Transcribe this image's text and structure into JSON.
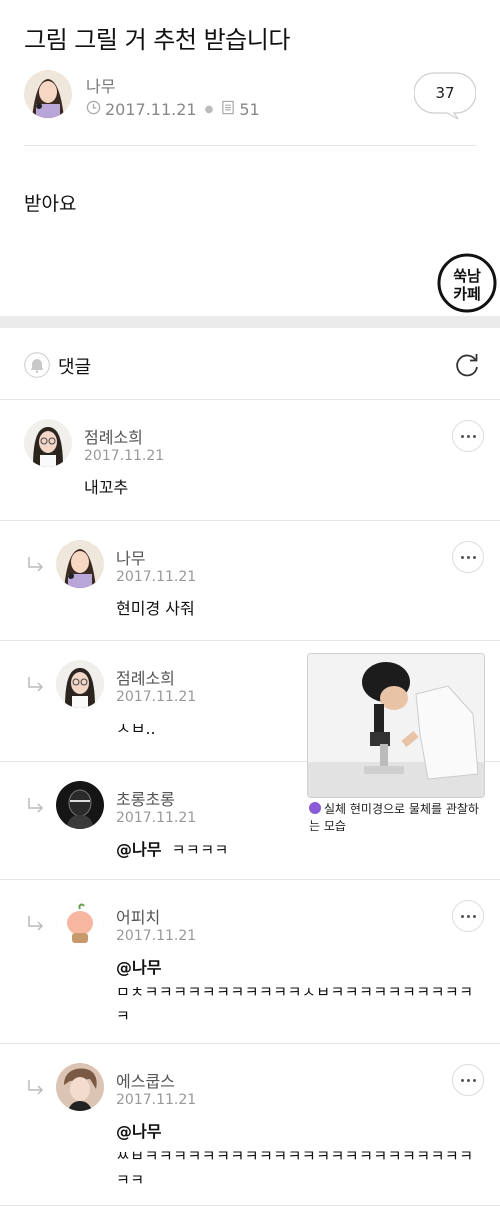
{
  "post": {
    "title": "그림 그릴 거 추천 받습니다",
    "author": "나무",
    "date": "2017.11.21",
    "views": "51",
    "comment_count": "37",
    "body": "받아요",
    "badge_line1": "쑥남",
    "badge_line2": "카페"
  },
  "comments_section": {
    "label": "댓글",
    "icons": [
      "bell-icon",
      "refresh-icon"
    ]
  },
  "comments": [
    {
      "author": "점례소희",
      "date": "2017.11.21",
      "text": "내꼬추",
      "reply": false
    },
    {
      "author": "나무",
      "date": "2017.11.21",
      "text": "현미경 사줘",
      "reply": true
    },
    {
      "author": "점례소희",
      "date": "2017.11.21",
      "text": "ㅅㅂ..",
      "reply": true
    },
    {
      "author": "초롱초롱",
      "date": "2017.11.21",
      "mention": "@나무",
      "text": "ㅋㅋㅋㅋ",
      "reply": true
    },
    {
      "author": "어피치",
      "date": "2017.11.21",
      "mention": "@나무",
      "text": "ㅁㅊㅋㅋㅋㅋㅋㅋㅋㅋㅋㅋㅋㅅㅂㅋㅋㅋㅋㅋㅋㅋㅋㅋㅋㅋ",
      "reply": true
    },
    {
      "author": "에스쿱스",
      "date": "2017.11.21",
      "mention": "@나무",
      "text": "ㅆㅂㅋㅋㅋㅋㅋㅋㅋㅋㅋㅋㅋㅋㅋㅋㅋㅋㅋㅋㅋㅋㅋㅋㅋㅋㅋ",
      "reply": true
    }
  ],
  "overlay": {
    "caption": "실체 현미경으로 물체를 관찰하는 모습"
  }
}
